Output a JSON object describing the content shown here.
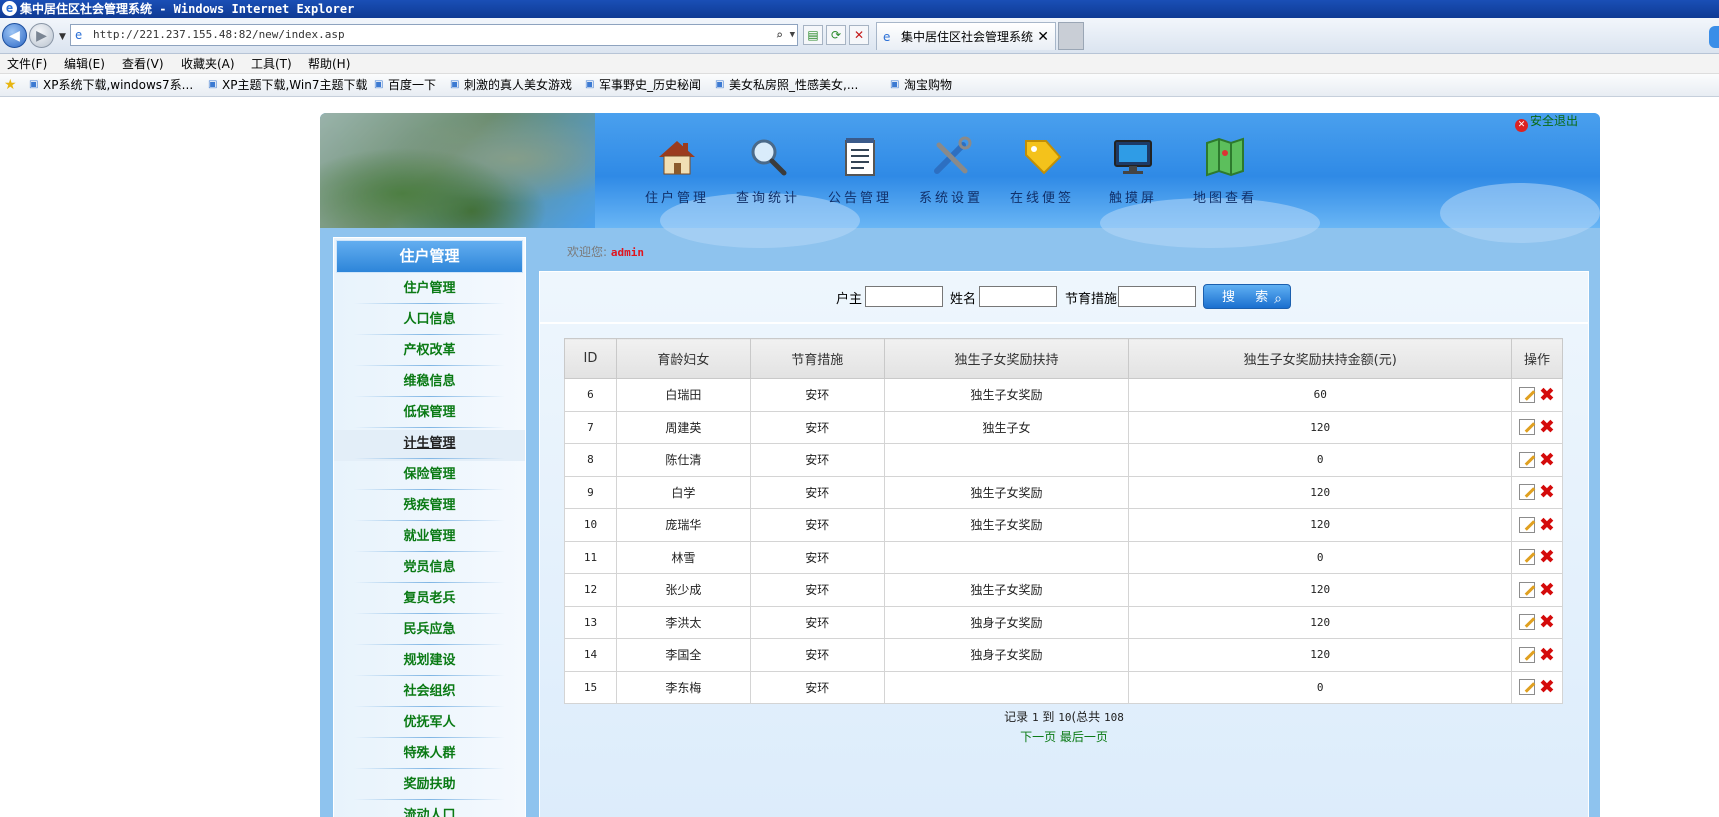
{
  "window": {
    "title": "集中居住区社会管理系统 - Windows Internet Explorer",
    "url": "http://221.237.155.48:82/new/index.asp",
    "tab_title": "集中居住区社会管理系统"
  },
  "menu": [
    "文件(F)",
    "编辑(E)",
    "查看(V)",
    "收藏夹(A)",
    "工具(T)",
    "帮助(H)"
  ],
  "favorites": [
    "XP系统下载,windows7系...",
    "XP主题下载,Win7主题下载",
    "百度一下",
    "刺激的真人美女游戏",
    "军事野史_历史秘闻",
    "美女私房照_性感美女,...",
    "淘宝购物"
  ],
  "header": {
    "logout": "安全退出",
    "nav": [
      "住户管理",
      "查询统计",
      "公告管理",
      "系统设置",
      "在线便签",
      "触摸屏",
      "地图查看"
    ]
  },
  "sidebar": {
    "title": "住户管理",
    "items": [
      "住户管理",
      "人口信息",
      "产权改革",
      "维稳信息",
      "低保管理",
      "计生管理",
      "保险管理",
      "残疾管理",
      "就业管理",
      "党员信息",
      "复员老兵",
      "民兵应急",
      "规划建设",
      "社会组织",
      "优抚军人",
      "特殊人群",
      "奖励扶助",
      "流动人口"
    ],
    "active_index": 5
  },
  "welcome": {
    "label": "欢迎您:",
    "user": "admin"
  },
  "search": {
    "fields": [
      "户主",
      "姓名",
      "节育措施"
    ],
    "button": "搜 索"
  },
  "table": {
    "headers": [
      "ID",
      "育龄妇女",
      "节育措施",
      "独生子女奖励扶持",
      "独生子女奖励扶持金额(元)",
      "操作"
    ],
    "rows": [
      [
        "6",
        "白瑞田",
        "安环",
        "独生子女奖励",
        "60"
      ],
      [
        "7",
        "周建英",
        "安环",
        "独生子女",
        "120"
      ],
      [
        "8",
        "陈仕清",
        "安环",
        "",
        "0"
      ],
      [
        "9",
        "白学",
        "安环",
        "独生子女奖励",
        "120"
      ],
      [
        "10",
        "庞瑞华",
        "安环",
        "独生子女奖励",
        "120"
      ],
      [
        "11",
        "林雪",
        "安环",
        "",
        "0"
      ],
      [
        "12",
        "张少成",
        "安环",
        "独生子女奖励",
        "120"
      ],
      [
        "13",
        "李洪太",
        "安环",
        "独身子女奖励",
        "120"
      ],
      [
        "14",
        "李国全",
        "安环",
        "独身子女奖励",
        "120"
      ],
      [
        "15",
        "李东梅",
        "安环",
        "",
        "0"
      ]
    ]
  },
  "pager": {
    "text_a": "记录",
    "from": "1",
    "text_b": "到",
    "to": "10",
    "text_c": "(总共",
    "total": "108",
    "next": "下一页",
    "last": "最后一页"
  }
}
